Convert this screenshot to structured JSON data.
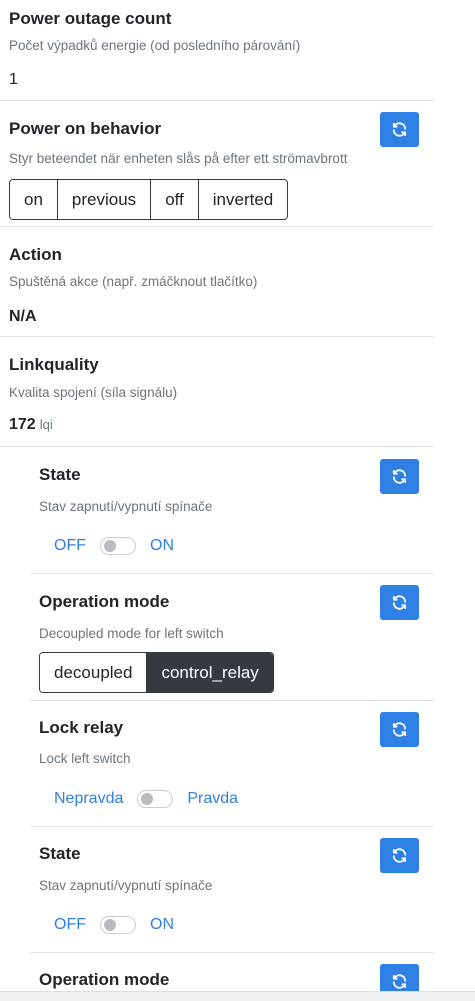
{
  "power_outage": {
    "title": "Power outage count",
    "description": "Počet výpadků energie (od posledního párování)",
    "value": "1"
  },
  "power_on_behavior": {
    "title": "Power on behavior",
    "description": "Styr beteendet när enheten slås på efter ett strömavbrott",
    "options": [
      "on",
      "previous",
      "off",
      "inverted"
    ]
  },
  "action": {
    "title": "Action",
    "description": "Spuštěná akce (např. zmáčknout tlačítko)",
    "value": "N/A"
  },
  "linkquality": {
    "title": "Linkquality",
    "description": "Kvalita spojení (síla signálu)",
    "value": "172",
    "unit": "lqi"
  },
  "left_state": {
    "title": "State",
    "description": "Stav zapnutí/vypnutí spínače",
    "off_label": "OFF",
    "on_label": "ON",
    "is_on": false
  },
  "left_operation_mode": {
    "title": "Operation mode",
    "description": "Decoupled mode for left switch",
    "options": [
      "decoupled",
      "control_relay"
    ],
    "selected": "control_relay"
  },
  "left_lock_relay": {
    "title": "Lock relay",
    "description": "Lock left switch",
    "false_label": "Nepravda",
    "true_label": "Pravda",
    "is_on": false
  },
  "right_state": {
    "title": "State",
    "description": "Stav zapnutí/vypnutí spínače",
    "off_label": "OFF",
    "on_label": "ON",
    "is_on": false
  },
  "right_operation_mode": {
    "title": "Operation mode"
  },
  "colors": {
    "accent": "#2f80e4",
    "dark": "#343a40",
    "muted": "#6c757d"
  },
  "icons": {
    "refresh": "refresh-icon"
  }
}
